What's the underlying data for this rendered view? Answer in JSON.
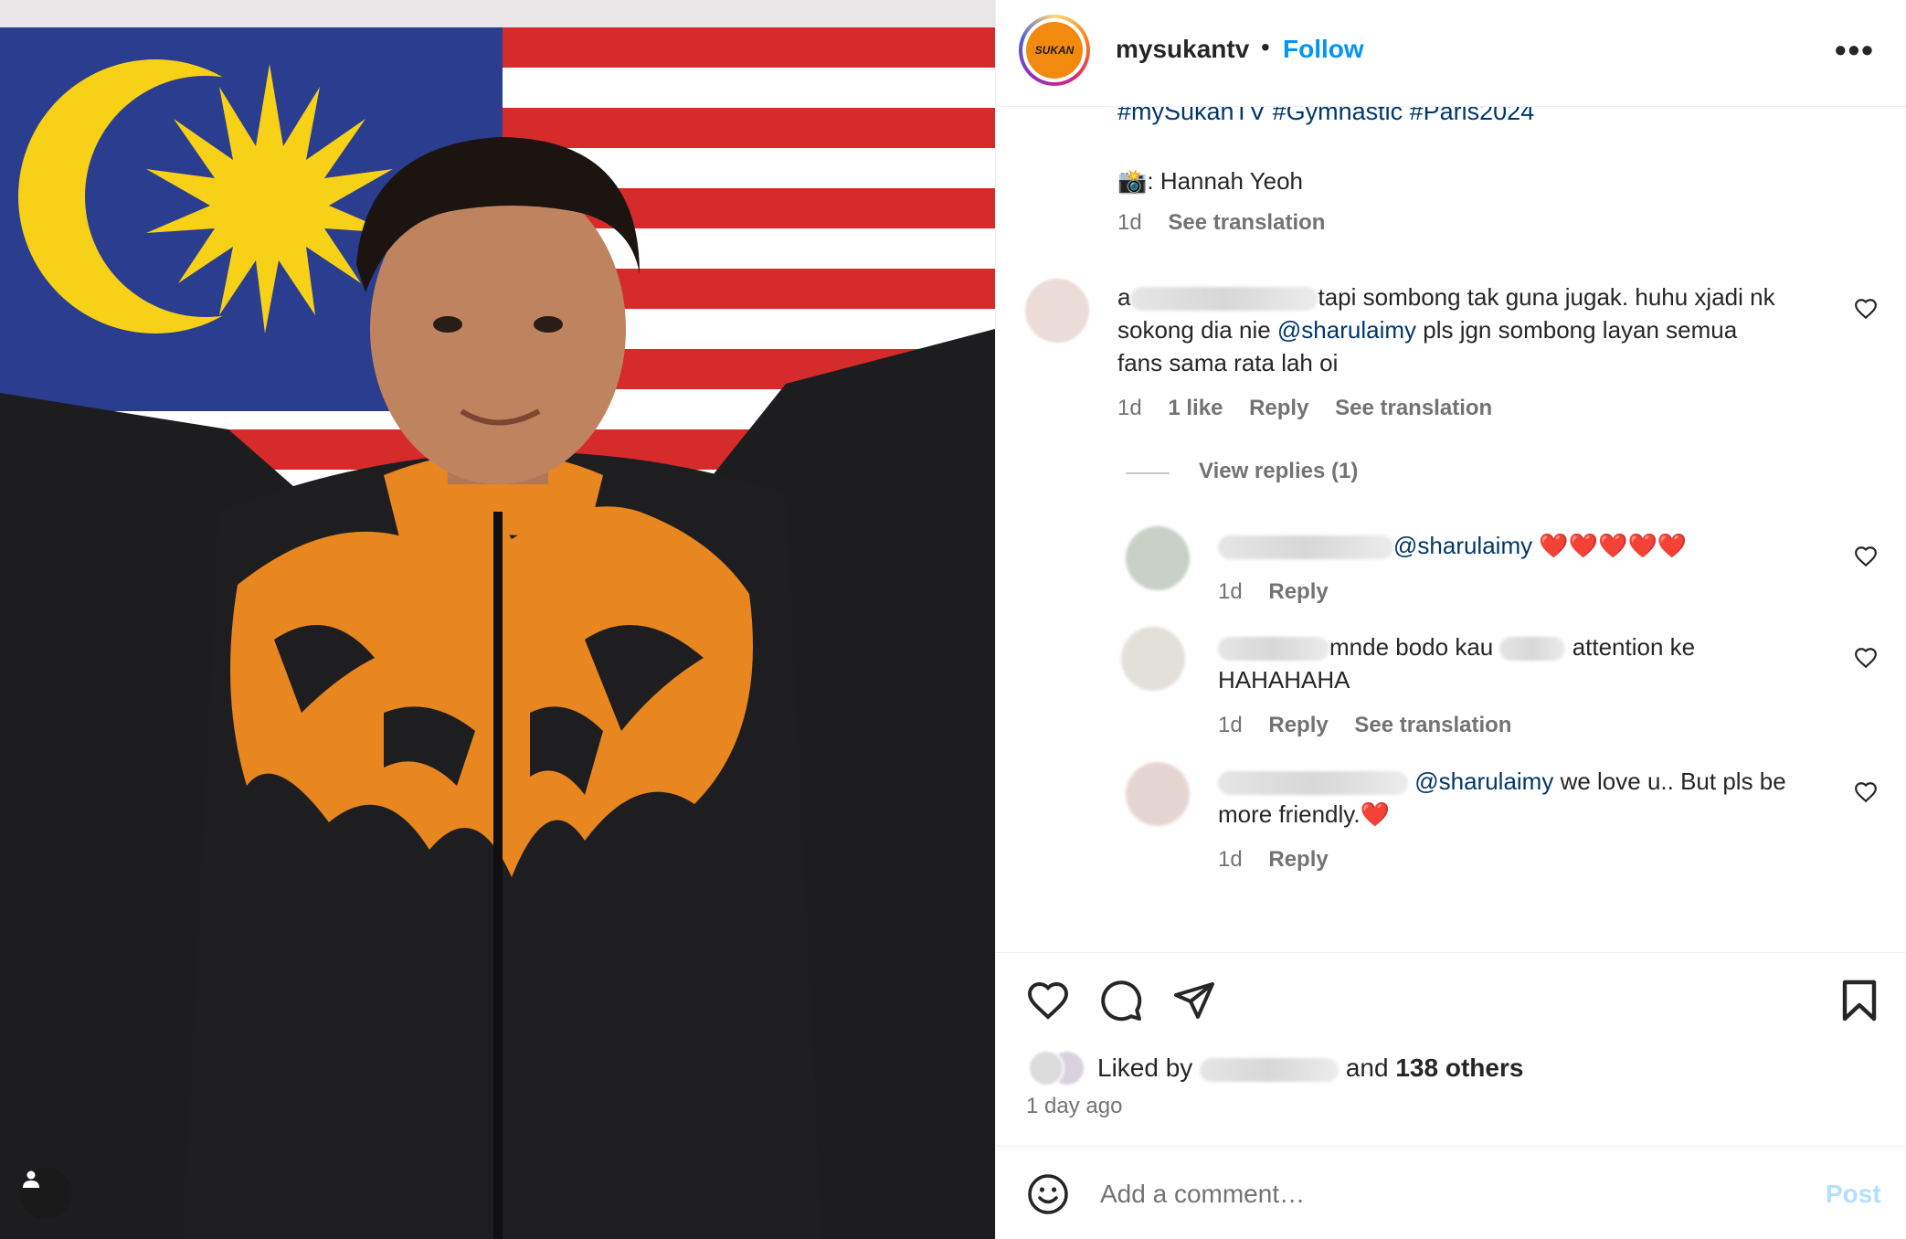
{
  "header": {
    "username": "mysukantv",
    "separator": "•",
    "follow_label": "Follow",
    "more_label": "•••",
    "logo_text": "SUKAN"
  },
  "caption": {
    "hashtags": "#mySukanTV #Gymnastic #Paris2024",
    "camera_emoji": "📸",
    "credit": ": Hannah Yeoh",
    "time": "1d",
    "see_translation": "See translation"
  },
  "comments": [
    {
      "prefix": "a",
      "line1": "tapi sombong tak guna jugak. huhu xjadi nk",
      "line2_a": "sokong dia nie ",
      "mention": "@sharulaimy",
      "line2_b": " pls jgn sombong layan semua",
      "line3": "fans sama rata lah oi",
      "time": "1d",
      "likes": "1 like",
      "reply": "Reply",
      "see_translation": "See translation",
      "view_replies": "View replies (1)"
    }
  ],
  "replies": [
    {
      "mention": "@sharulaimy",
      "text": "❤️❤️❤️❤️❤️",
      "time": "1d",
      "reply": "Reply"
    },
    {
      "text_a": "mnde bodo kau ",
      "text_b": " attention ke",
      "line2": "HAHAHAHA",
      "time": "1d",
      "reply": "Reply",
      "see_translation": "See translation"
    },
    {
      "mention": "@sharulaimy",
      "text": " we love u.. But pls be",
      "line2": "more friendly.❤️",
      "time": "1d",
      "reply": "Reply"
    }
  ],
  "likes": {
    "liked_by": "Liked by ",
    "and": "and ",
    "others": "138 others",
    "time_ago": "1 day ago"
  },
  "add_comment": {
    "placeholder": "Add a comment…",
    "post_label": "Post",
    "emoji_icon": "smiley-icon"
  },
  "colors": {
    "link_blue": "#0095f6",
    "mention": "#00376b",
    "meta_gray": "#737373",
    "post_disabled": "#b2dffc",
    "heart_red": "#ed1c24"
  }
}
